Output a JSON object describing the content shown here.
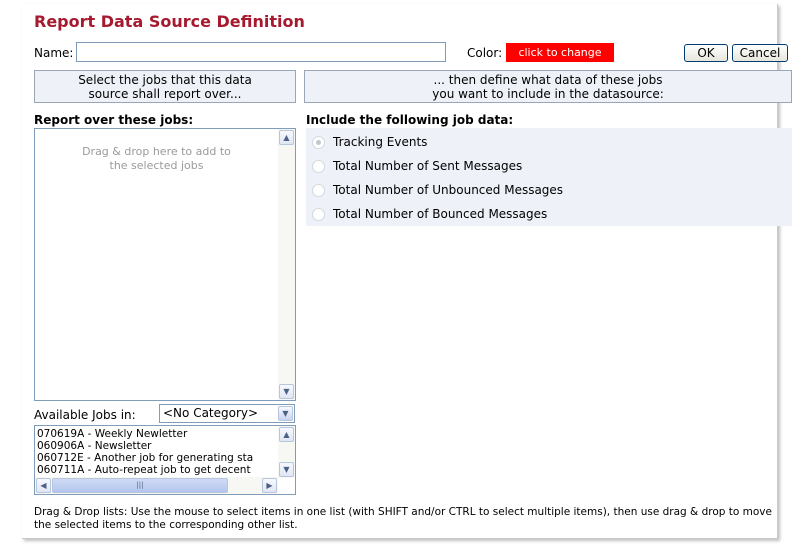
{
  "dialog": {
    "title": "Report Data Source Definition",
    "name_label": "Name:",
    "name_value": "",
    "color_label": "Color:",
    "color_button": "click to change",
    "color_value": "#ff0000",
    "ok_label": "OK",
    "cancel_label": "Cancel"
  },
  "steps": {
    "step1": "Select the jobs that this data source shall report over...",
    "step2": "... then define what data of these jobs you want to include in the datasource:"
  },
  "left": {
    "heading": "Report over these jobs:",
    "drag_hint": "Drag & drop here to add to the selected jobs",
    "available_label": "Available Jobs in:",
    "category_selected": "<No Category>",
    "jobs": [
      "070619A - Weekly Newletter",
      "060906A - Newsletter",
      "060712E - Another job for generating sta",
      "060711A - Auto-repeat job to get decent"
    ]
  },
  "right": {
    "heading": "Include the following job data:",
    "options": [
      {
        "label": "Tracking Events",
        "checked": true
      },
      {
        "label": "Total Number of Sent Messages",
        "checked": false
      },
      {
        "label": "Total Number of Unbounced Messages",
        "checked": false
      },
      {
        "label": "Total Number of Bounced Messages",
        "checked": false
      }
    ]
  },
  "help_text": "Drag & Drop lists: Use the mouse to select items in one list (with SHIFT and/or CTRL to select multiple items), then use drag & drop to move the selected items to the corresponding other list.",
  "colors": {
    "title": "#a6192e",
    "panel_bg": "#eef2f8"
  }
}
